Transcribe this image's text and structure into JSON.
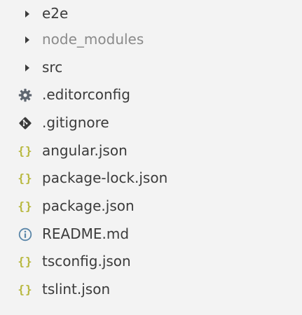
{
  "explorer": {
    "items": [
      {
        "label": "e2e",
        "type": "folder",
        "icon": "chevron-right-icon",
        "muted": false
      },
      {
        "label": "node_modules",
        "type": "folder",
        "icon": "chevron-right-icon",
        "muted": true
      },
      {
        "label": "src",
        "type": "folder",
        "icon": "chevron-right-icon",
        "muted": false
      },
      {
        "label": ".editorconfig",
        "type": "file",
        "icon": "gear-icon"
      },
      {
        "label": ".gitignore",
        "type": "file",
        "icon": "git-icon"
      },
      {
        "label": "angular.json",
        "type": "file",
        "icon": "json-braces-icon"
      },
      {
        "label": "package-lock.json",
        "type": "file",
        "icon": "json-braces-icon"
      },
      {
        "label": "package.json",
        "type": "file",
        "icon": "json-braces-icon"
      },
      {
        "label": "README.md",
        "type": "file",
        "icon": "info-icon"
      },
      {
        "label": "tsconfig.json",
        "type": "file",
        "icon": "json-braces-icon"
      },
      {
        "label": "tslint.json",
        "type": "file",
        "icon": "json-braces-icon"
      }
    ]
  },
  "colors": {
    "background": "#f3f3f3",
    "text": "#3b3b3b",
    "muted_text": "#8a8a8a",
    "json_icon": "#b7b73b",
    "info_icon": "#5a86a8",
    "gear_icon": "#5f6670",
    "git_icon": "#3a3a3a"
  }
}
